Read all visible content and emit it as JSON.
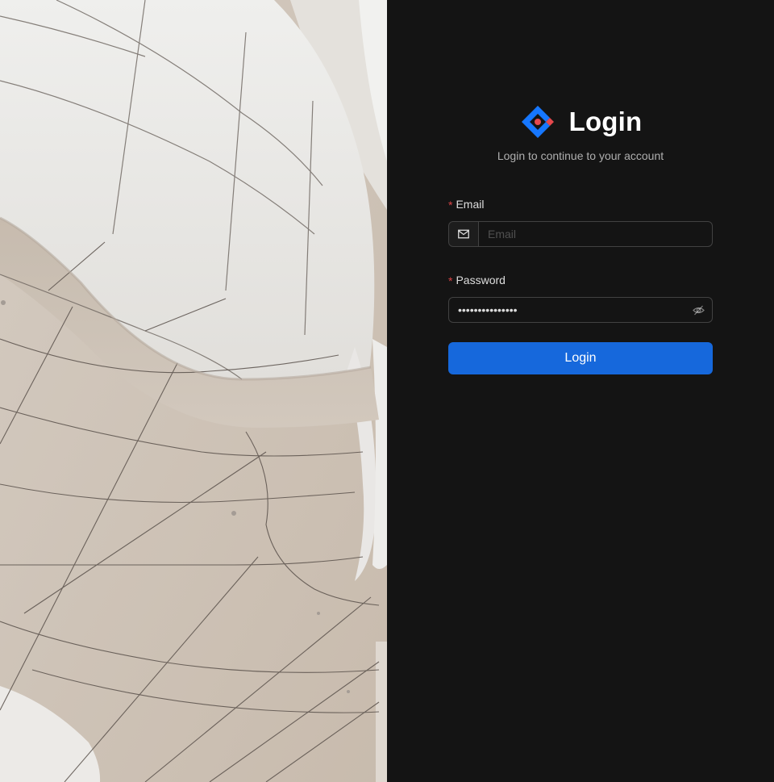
{
  "brand": {
    "title": "Login",
    "subtitle": "Login to continue to your account",
    "logo_icon": "diamond-logo-icon"
  },
  "form": {
    "email": {
      "label": "Email",
      "required_mark": "*",
      "placeholder": "Email",
      "value": "",
      "icon": "mail-icon"
    },
    "password": {
      "label": "Password",
      "required_mark": "*",
      "value": "•••••••••••••••",
      "icon": "eye-invisible-icon"
    },
    "submit_label": "Login"
  },
  "colors": {
    "background": "#141414",
    "primary": "#1668dc",
    "required": "#dc4446",
    "logo_blue": "#1677ff",
    "logo_red": "#e5484d"
  },
  "hero": {
    "description_icon": "architecture-photo"
  }
}
